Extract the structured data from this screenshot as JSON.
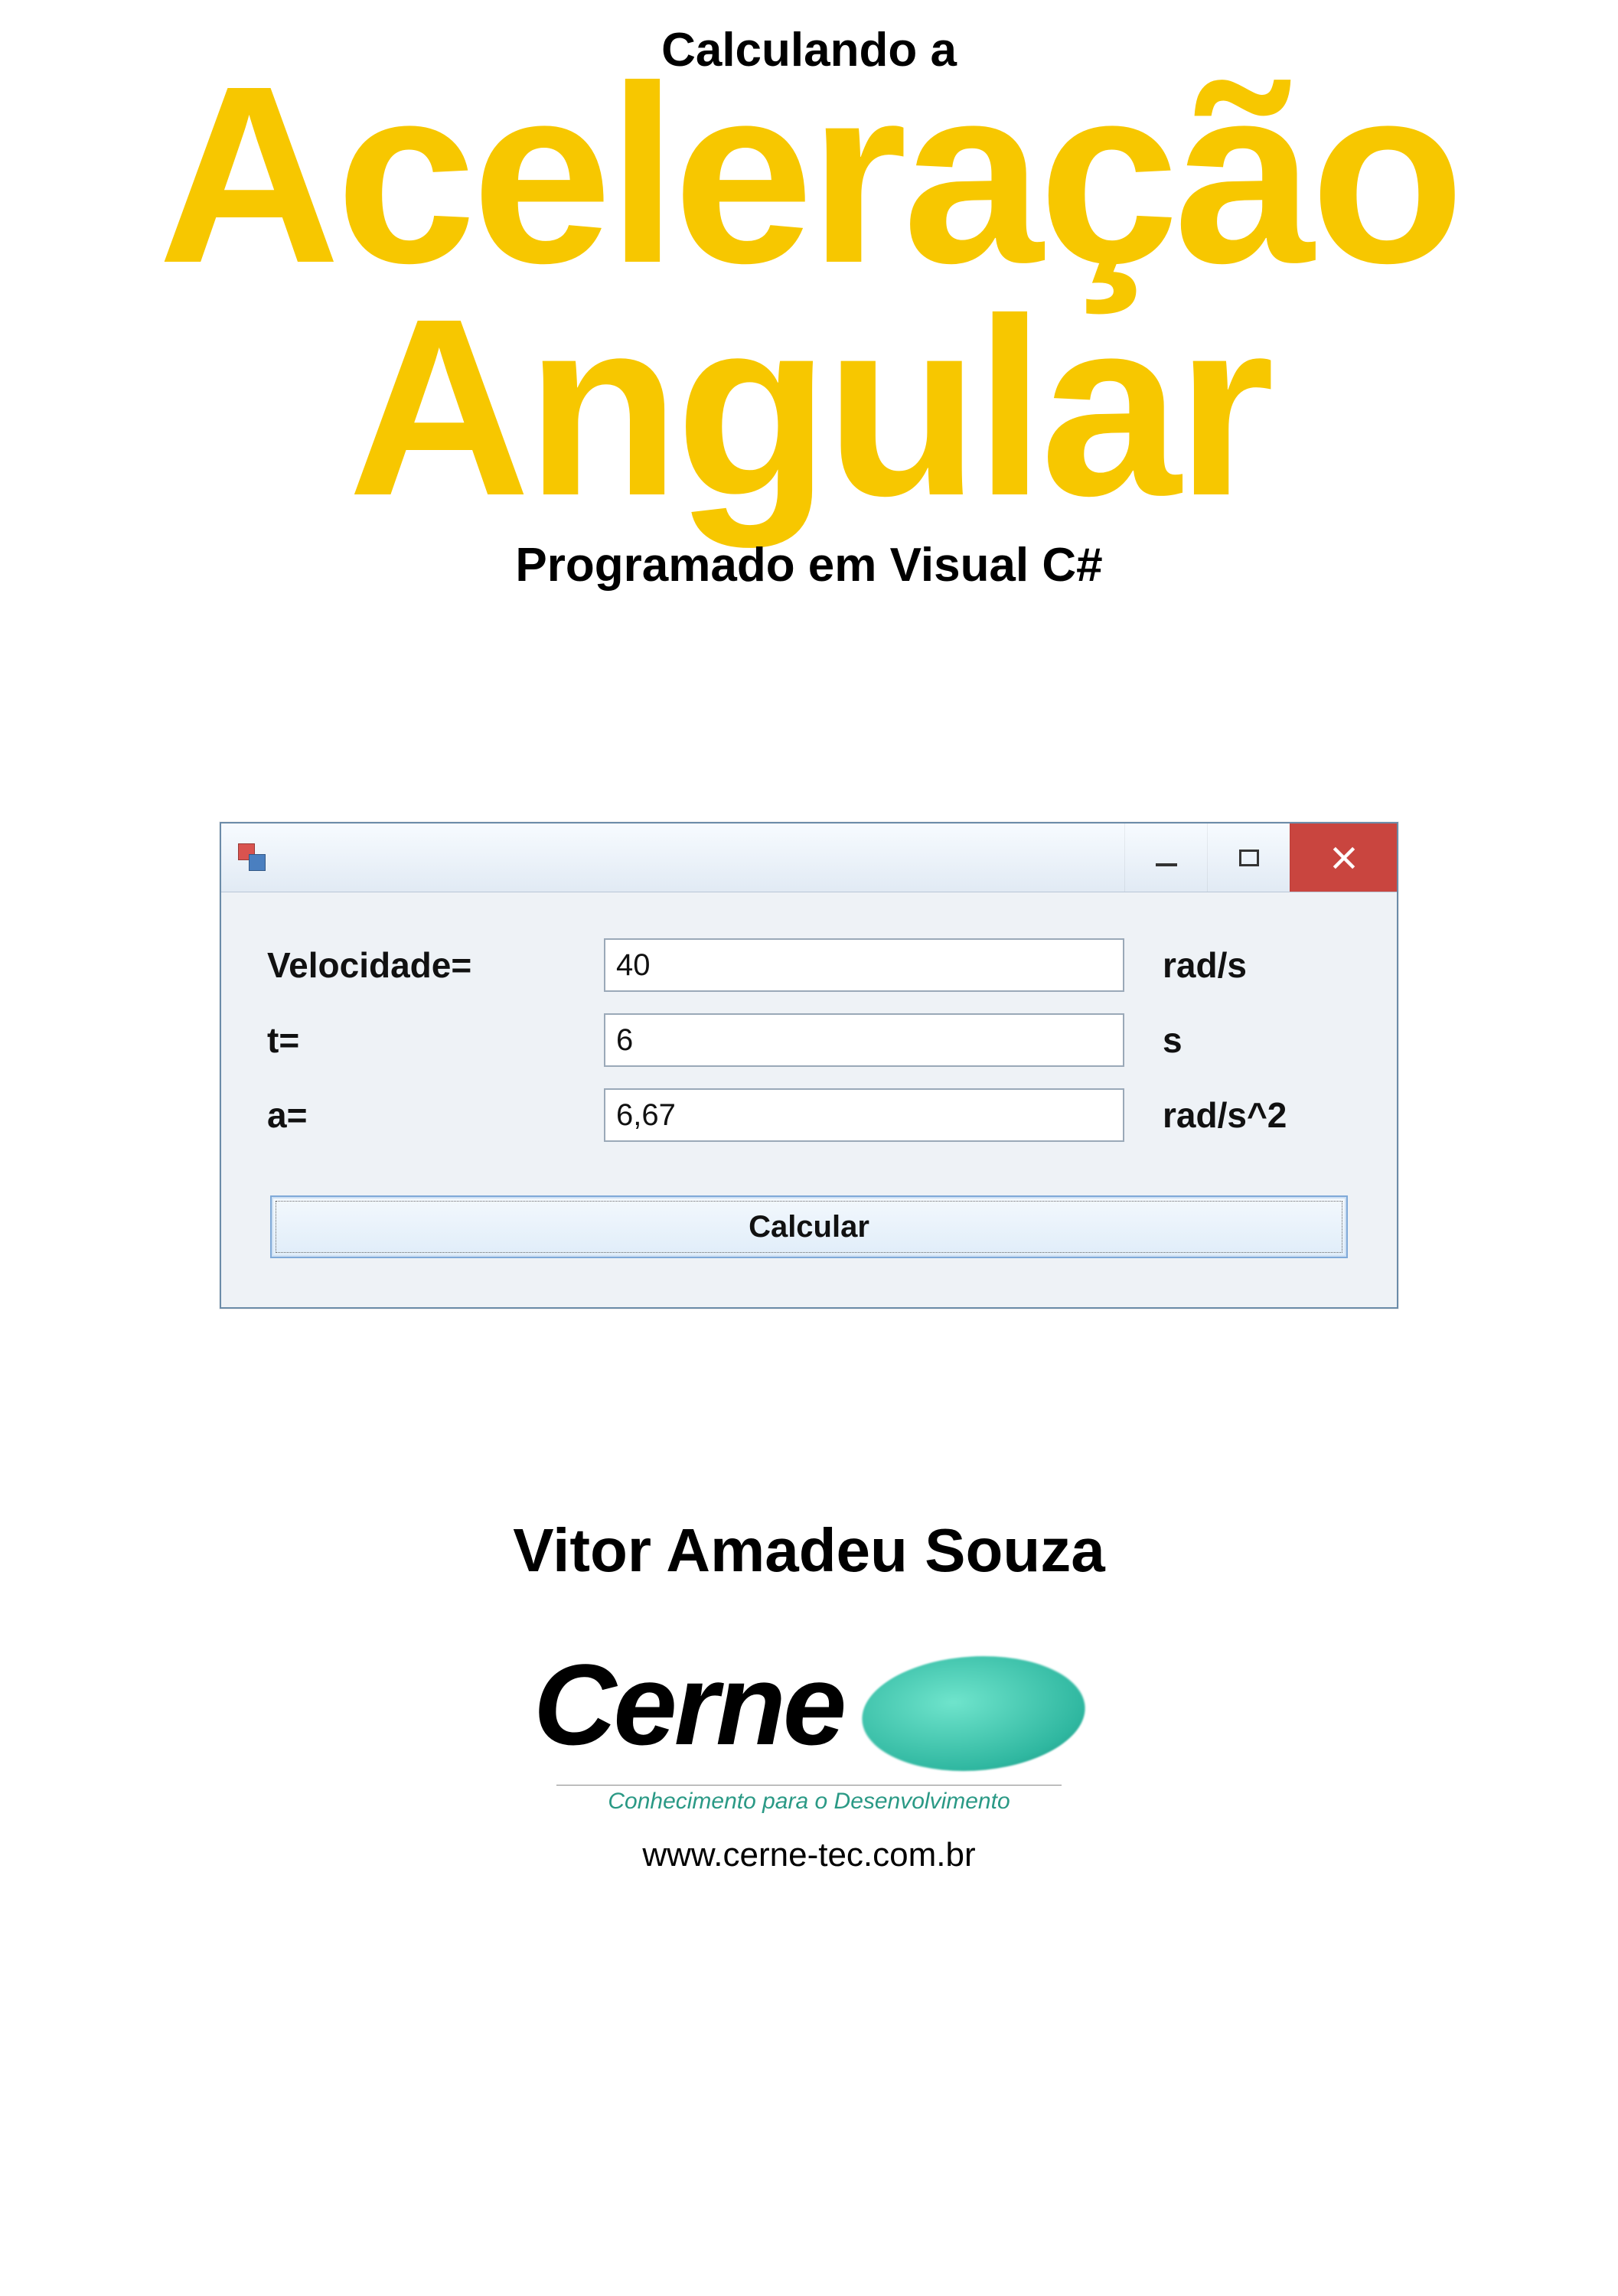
{
  "header": {
    "supertitle": "Calculando a",
    "title_line1": "Aceleração",
    "title_line2": "Angular",
    "subtitle": "Programado em Visual C#"
  },
  "window": {
    "rows": [
      {
        "label": "Velocidade=",
        "value": "40",
        "unit": "rad/s"
      },
      {
        "label": "t=",
        "value": "6",
        "unit": "s"
      },
      {
        "label": "a=",
        "value": "6,67",
        "unit": "rad/s^2"
      }
    ],
    "button_label": "Calcular"
  },
  "author": "Vitor Amadeu Souza",
  "logo": {
    "brand": "Cerne",
    "tagline": "Conhecimento para o Desenvolvimento",
    "url": "www.cerne-tec.com.br"
  }
}
